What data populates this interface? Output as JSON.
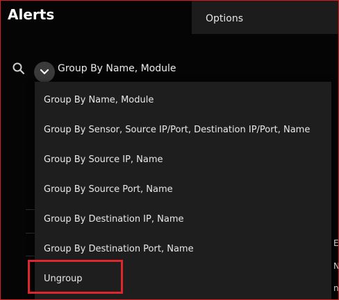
{
  "header": {
    "title": "Alerts",
    "options_label": "Options"
  },
  "grouping": {
    "current_label": "Group By Name, Module",
    "menu_items": [
      "Group By Name, Module",
      "Group By Sensor, Source IP/Port, Destination IP/Port, Name",
      "Group By Source IP, Name",
      "Group By Source Port, Name",
      "Group By Destination IP, Name",
      "Group By Destination Port, Name",
      "Ungroup"
    ]
  },
  "background_table": {
    "clipped_cells": [
      "E",
      "N",
      "n"
    ]
  },
  "icons": {
    "search": "search-icon",
    "toggle": "chevron-down-icon"
  },
  "colors": {
    "highlight": "#e0262a",
    "menu_bg": "#1e1e1e",
    "page_bg": "#050505"
  }
}
